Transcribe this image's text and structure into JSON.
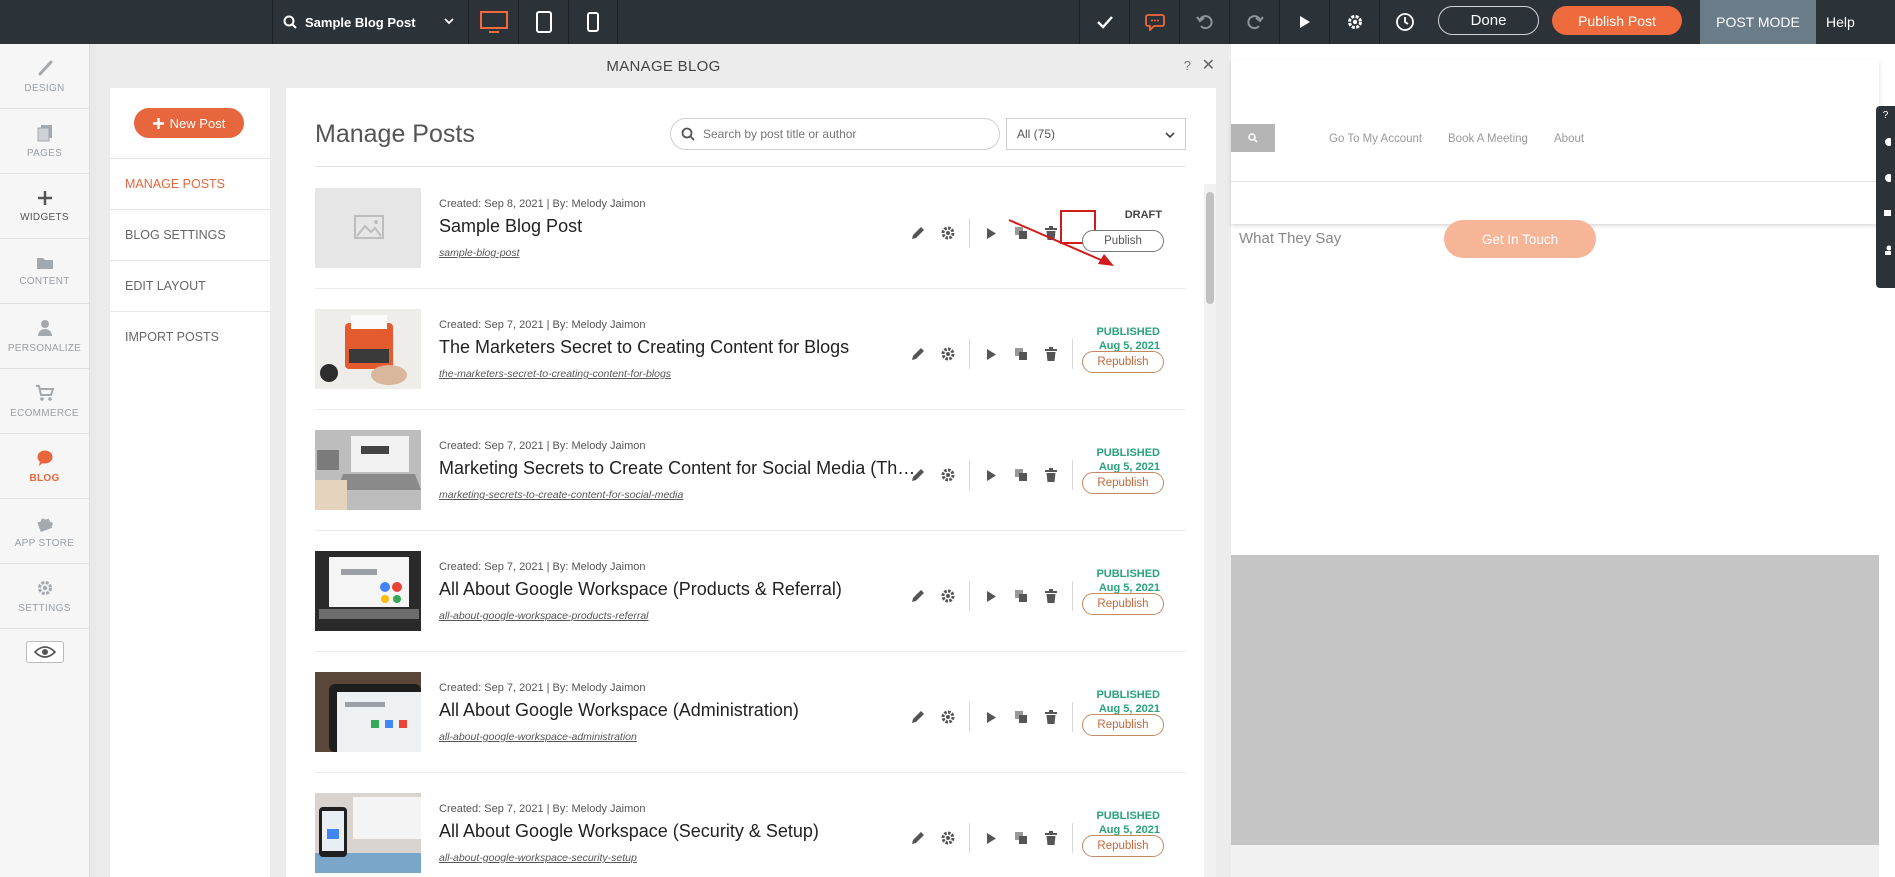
{
  "topbar": {
    "page_name": "Sample Blog Post",
    "done_label": "Done",
    "publish_label": "Publish Post",
    "mode_label": "POST MODE",
    "help_label": "Help",
    "colors": {
      "bar": "#2c3338",
      "accent": "#ef6a3d"
    }
  },
  "sidebar": {
    "items": [
      {
        "label": "DESIGN",
        "icon": "brush-icon"
      },
      {
        "label": "PAGES",
        "icon": "pages-icon"
      },
      {
        "label": "WIDGETS",
        "icon": "plus-icon"
      },
      {
        "label": "CONTENT",
        "icon": "folder-icon"
      },
      {
        "label": "PERSONALIZE",
        "icon": "person-icon"
      },
      {
        "label": "ECOMMERCE",
        "icon": "cart-icon"
      },
      {
        "label": "BLOG",
        "icon": "chat-bubble-icon"
      },
      {
        "label": "APP STORE",
        "icon": "puzzle-icon"
      },
      {
        "label": "SETTINGS",
        "icon": "gear-icon"
      }
    ]
  },
  "panel": {
    "title": "MANAGE BLOG",
    "help": "?",
    "close": "✕"
  },
  "subnav": {
    "new_post_label": "New Post",
    "items": [
      {
        "label": "MANAGE POSTS"
      },
      {
        "label": "BLOG SETTINGS"
      },
      {
        "label": "EDIT LAYOUT"
      },
      {
        "label": "IMPORT POSTS"
      }
    ]
  },
  "content": {
    "title": "Manage Posts",
    "search_placeholder": "Search by post title or author",
    "filter_value": "All (75)"
  },
  "posts": [
    {
      "meta": "Created: Sep 8, 2021 | By: Melody Jaimon",
      "title": "Sample Blog Post",
      "slug": "sample-blog-post",
      "status": "DRAFT",
      "date": "",
      "button": "Publish"
    },
    {
      "meta": "Created: Sep 7, 2021 | By: Melody Jaimon",
      "title": "The Marketers Secret to Creating Content for Blogs",
      "slug": "the-marketers-secret-to-creating-content-for-blogs",
      "status": "PUBLISHED",
      "date": "Aug 5, 2021",
      "button": "Republish"
    },
    {
      "meta": "Created: Sep 7, 2021 | By: Melody Jaimon",
      "title": "Marketing Secrets to Create Content for Social Media (Th…",
      "slug": "marketing-secrets-to-create-content-for-social-media",
      "status": "PUBLISHED",
      "date": "Aug 5, 2021",
      "button": "Republish"
    },
    {
      "meta": "Created: Sep 7, 2021 | By: Melody Jaimon",
      "title": "All About Google Workspace (Products & Referral)",
      "slug": "all-about-google-workspace-products-referral",
      "status": "PUBLISHED",
      "date": "Aug 5, 2021",
      "button": "Republish"
    },
    {
      "meta": "Created: Sep 7, 2021 | By: Melody Jaimon",
      "title": "All About Google Workspace (Administration)",
      "slug": "all-about-google-workspace-administration",
      "status": "PUBLISHED",
      "date": "Aug 5, 2021",
      "button": "Republish"
    },
    {
      "meta": "Created: Sep 7, 2021 | By: Melody Jaimon",
      "title": "All About Google Workspace (Security & Setup)",
      "slug": "all-about-google-workspace-security-setup",
      "status": "PUBLISHED",
      "date": "Aug 5, 2021",
      "button": "Republish"
    }
  ],
  "preview": {
    "nav": [
      "Go To My Account",
      "Book A Meeting",
      "About"
    ],
    "section_text": "What They Say",
    "cta_label": "Get In Touch",
    "side_tab_help": "?"
  }
}
